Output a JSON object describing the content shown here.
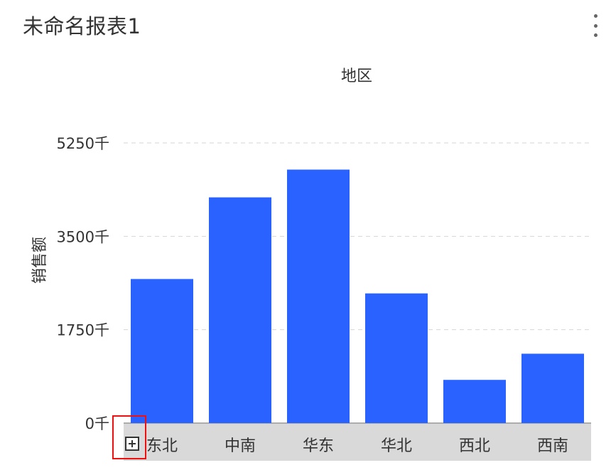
{
  "report": {
    "title": "未命名报表1",
    "menu_icon": "more-vertical-icon",
    "expand_icon": "plus-square-icon"
  },
  "chart_data": {
    "type": "bar",
    "title": "地区",
    "xlabel": "",
    "ylabel": "销售额",
    "categories": [
      "东北",
      "中南",
      "华东",
      "华北",
      "西北",
      "西南"
    ],
    "values": [
      2700,
      4230,
      4750,
      2430,
      810,
      1300
    ],
    "ylim": [
      0,
      5250
    ],
    "yticks": [
      0,
      1750,
      3500,
      5250
    ],
    "ytick_labels": [
      "0千",
      "1750千",
      "3500千",
      "5250千"
    ],
    "grid": true,
    "bar_color": "#2962ff",
    "axis_band_color": "#d9d9d9"
  }
}
